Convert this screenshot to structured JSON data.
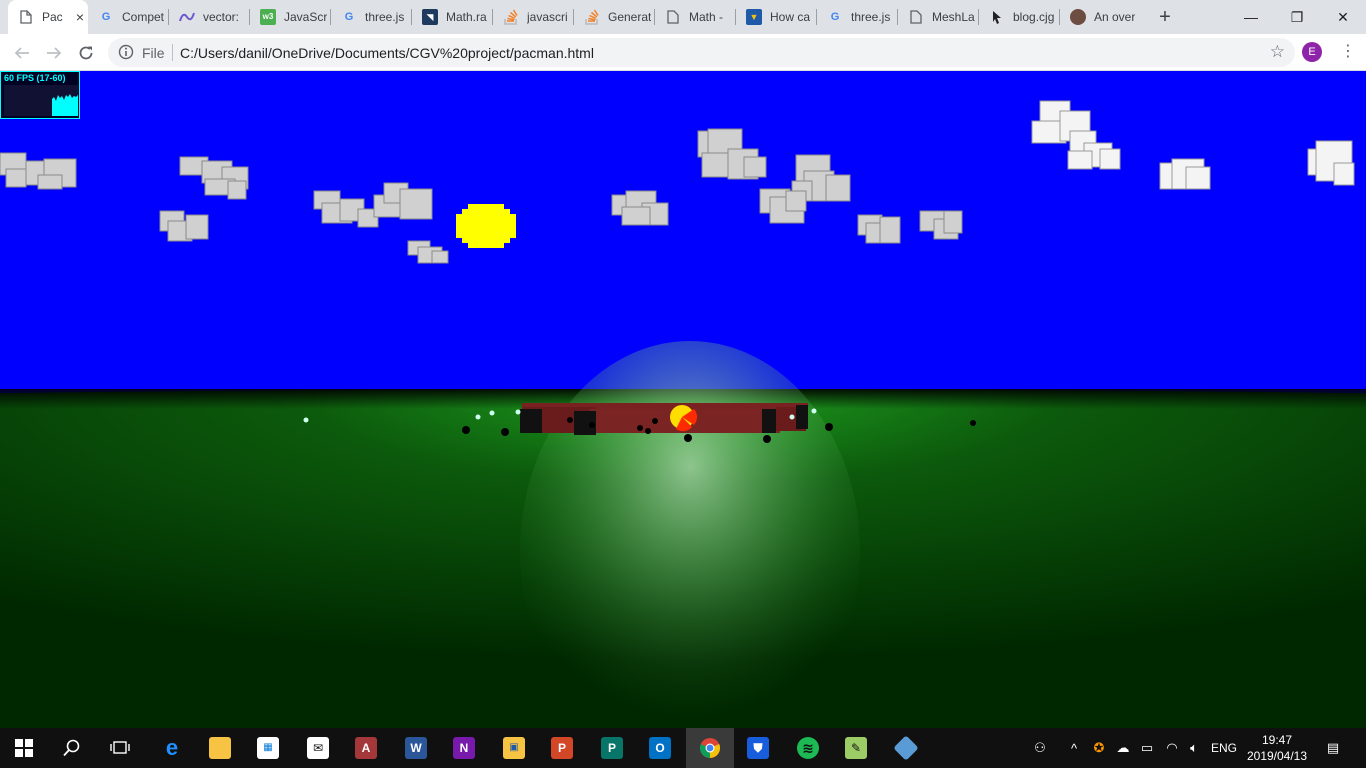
{
  "browser": {
    "tabs": [
      {
        "title": "Pac",
        "favicon": "page-icon",
        "active": true
      },
      {
        "title": "Compet",
        "favicon": "google-icon"
      },
      {
        "title": "vector:",
        "favicon": "desmos-icon"
      },
      {
        "title": "JavaScr",
        "favicon": "w3schools-icon"
      },
      {
        "title": "three.js",
        "favicon": "google-icon"
      },
      {
        "title": "Math.ra",
        "favicon": "docs-icon"
      },
      {
        "title": "javascri",
        "favicon": "stackoverflow-icon"
      },
      {
        "title": "Generat",
        "favicon": "stackoverflow-icon"
      },
      {
        "title": "Math -",
        "favicon": "page-icon"
      },
      {
        "title": "How ca",
        "favicon": "bookmark-icon"
      },
      {
        "title": "three.js",
        "favicon": "google-icon"
      },
      {
        "title": "MeshLa",
        "favicon": "page-icon"
      },
      {
        "title": "blog.cjg",
        "favicon": "cursor-icon"
      },
      {
        "title": "An over",
        "favicon": "avatar-icon"
      }
    ],
    "new_tab": "+",
    "close_tab": "×",
    "window_controls": {
      "minimize": "—",
      "restore": "❐",
      "close": "✕"
    },
    "omnibox": {
      "scheme_label": "File",
      "url": "C:/Users/danil/OneDrive/Documents/CGV%20project/pacman.html"
    },
    "profile_initial": "E"
  },
  "scene": {
    "stats": {
      "fps_text": "60 FPS (17-60)"
    },
    "colors": {
      "sky": "#0000ff",
      "ground_light": "#1fa01f",
      "ground_dark": "#002800",
      "sun": "#ffff00",
      "maze_wall": "#7a2222",
      "pacman_yellow": "#ffdd00",
      "pacman_red": "#ff2a00",
      "cloud": "#d9d9d9"
    }
  },
  "taskbar": {
    "apps": [
      {
        "name": "start-icon",
        "active": false
      },
      {
        "name": "search-icon",
        "active": false
      },
      {
        "name": "task-view-icon",
        "active": false
      },
      {
        "name": "edge-icon",
        "active": false
      },
      {
        "name": "file-explorer-icon",
        "active": false
      },
      {
        "name": "store-icon",
        "active": false
      },
      {
        "name": "mail-icon",
        "active": false
      },
      {
        "name": "access-icon",
        "active": false
      },
      {
        "name": "word-icon",
        "active": false
      },
      {
        "name": "onenote-icon",
        "active": false
      },
      {
        "name": "folder-icon",
        "active": false
      },
      {
        "name": "powerpoint-icon",
        "active": false
      },
      {
        "name": "publisher-icon",
        "active": false
      },
      {
        "name": "outlook-icon",
        "active": false
      },
      {
        "name": "chrome-icon",
        "active": true
      },
      {
        "name": "bitwarden-icon",
        "active": false
      },
      {
        "name": "spotify-icon",
        "active": false
      },
      {
        "name": "notepad-icon",
        "active": false
      },
      {
        "name": "git-icon",
        "active": false
      }
    ],
    "tray": {
      "language": "ENG",
      "time": "19:47",
      "date": "2019/04/13"
    }
  }
}
